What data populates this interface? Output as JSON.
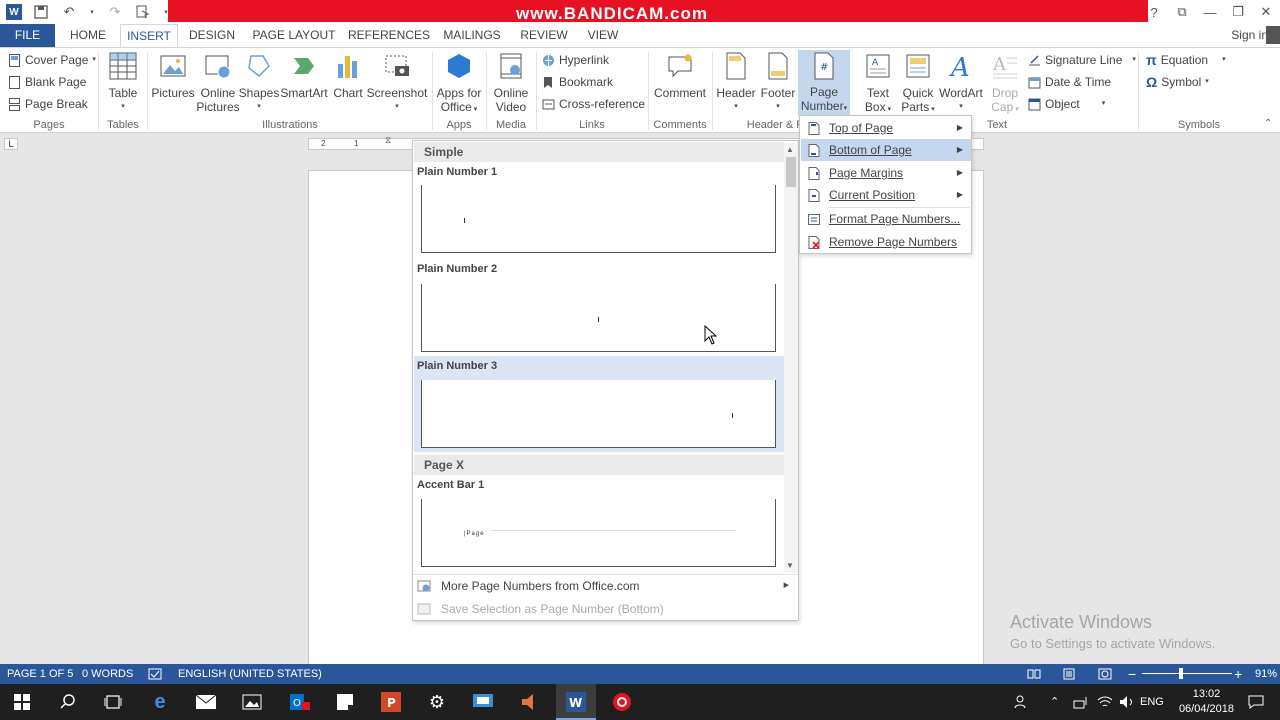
{
  "watermark": "www.BANDICAM.com",
  "window": {
    "help": "?",
    "sign_in": "Sign in"
  },
  "tabs": [
    {
      "label": "FILE"
    },
    {
      "label": "HOME"
    },
    {
      "label": "INSERT"
    },
    {
      "label": "DESIGN"
    },
    {
      "label": "PAGE LAYOUT"
    },
    {
      "label": "REFERENCES"
    },
    {
      "label": "MAILINGS"
    },
    {
      "label": "REVIEW"
    },
    {
      "label": "VIEW"
    }
  ],
  "ribbon": {
    "pages": {
      "cover_page": "Cover Page",
      "blank_page": "Blank Page",
      "page_break": "Page Break",
      "label": "Pages"
    },
    "tables": {
      "table": "Table",
      "label": "Tables"
    },
    "illustrations": {
      "pictures": "Pictures",
      "online_pictures_1": "Online",
      "online_pictures_2": "Pictures",
      "shapes": "Shapes",
      "smartart": "SmartArt",
      "chart": "Chart",
      "screenshot": "Screenshot",
      "label": "Illustrations"
    },
    "apps": {
      "apps_1": "Apps for",
      "apps_2": "Office",
      "label": "Apps"
    },
    "media": {
      "video_1": "Online",
      "video_2": "Video",
      "label": "Media"
    },
    "links": {
      "hyperlink": "Hyperlink",
      "bookmark": "Bookmark",
      "cross_reference": "Cross-reference",
      "label": "Links"
    },
    "comments": {
      "comment": "Comment",
      "label": "Comments"
    },
    "header_footer": {
      "header": "Header",
      "footer": "Footer",
      "page_number_1": "Page",
      "page_number_2": "Number",
      "label": "Header & F"
    },
    "text": {
      "text_box_1": "Text",
      "text_box_2": "Box",
      "quick_parts_1": "Quick",
      "quick_parts_2": "Parts",
      "wordart": "WordArt",
      "drop_cap_1": "Drop",
      "drop_cap_2": "Cap",
      "signature_line": "Signature Line",
      "date_time": "Date & Time",
      "object": "Object",
      "label": "Text"
    },
    "symbols": {
      "equation": "Equation",
      "symbol": "Symbol",
      "label": "Symbols"
    }
  },
  "ruler": {
    "corner": "L",
    "tick_2": "2",
    "tick_1": "1"
  },
  "gallery": {
    "section_simple": "Simple",
    "items": [
      {
        "title": "Plain Number 1"
      },
      {
        "title": "Plain Number 2"
      },
      {
        "title": "Plain Number 3"
      }
    ],
    "section_page_x": "Page X",
    "accent_bar": {
      "title": "Accent Bar 1",
      "preview_text": "|Page"
    },
    "more": "More Page Numbers from Office.com",
    "save_selection": "Save Selection as Page Number (Bottom)"
  },
  "menu": {
    "items": [
      {
        "label": "Top of Page"
      },
      {
        "label": "Bottom of Page"
      },
      {
        "label": "Page Margins"
      },
      {
        "label": "Current Position"
      },
      {
        "label": "Format Page Numbers..."
      },
      {
        "label": "Remove Page Numbers"
      }
    ]
  },
  "activate": {
    "title": "Activate Windows",
    "subtitle": "Go to Settings to activate Windows."
  },
  "status": {
    "page": "PAGE 1 OF 5",
    "words": "0 WORDS",
    "language": "ENGLISH (UNITED STATES)",
    "zoom": "91%"
  },
  "taskbar": {
    "language": "ENG",
    "time": "13:02",
    "date": "06/04/2018"
  },
  "colors": {
    "accent": "#2b579a",
    "watermark_bar": "#e81123",
    "menu_highlight": "#c5d7ef"
  }
}
